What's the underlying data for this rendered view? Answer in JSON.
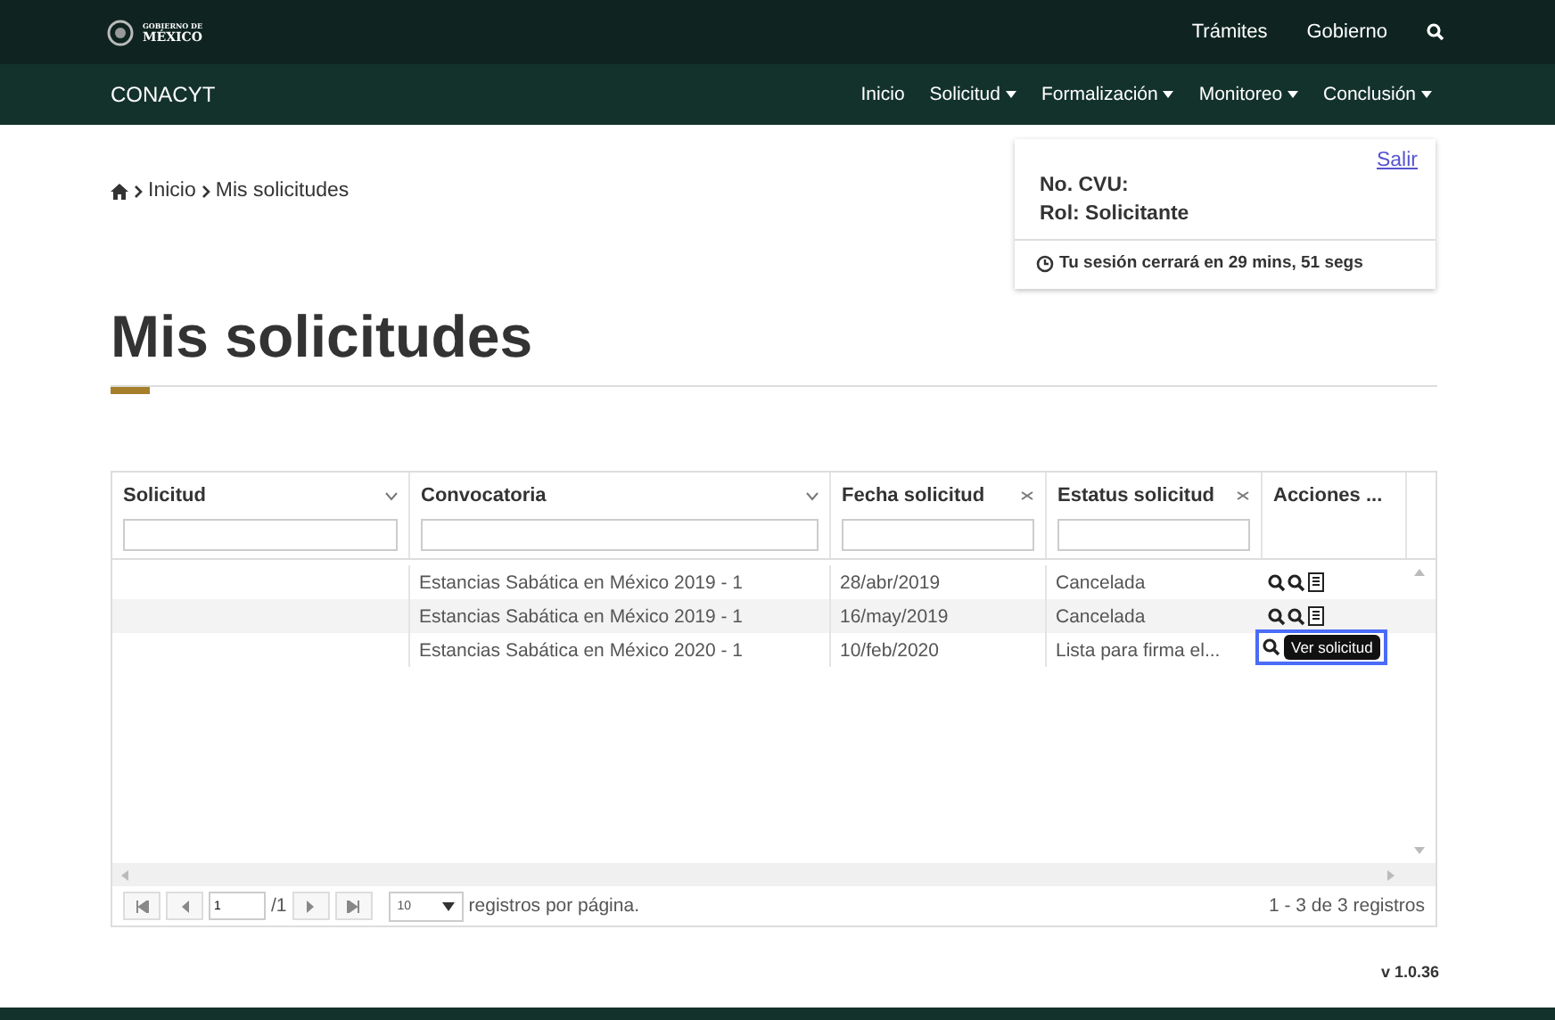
{
  "top_bar": {
    "logo_line_1": "GOBIERNO DE",
    "logo_line_2": "MÉXICO",
    "links": [
      "Trámites",
      "Gobierno"
    ]
  },
  "nav": {
    "brand": "CONACYT",
    "items": [
      {
        "label": "Inicio",
        "dropdown": false
      },
      {
        "label": "Solicitud",
        "dropdown": true
      },
      {
        "label": "Formalización",
        "dropdown": true
      },
      {
        "label": "Monitoreo",
        "dropdown": true
      },
      {
        "label": "Conclusión",
        "dropdown": true
      }
    ]
  },
  "breadcrumb": [
    "Inicio",
    "Mis solicitudes"
  ],
  "session": {
    "logout": "Salir",
    "cvu": "No. CVU:",
    "role": "Rol: Solicitante",
    "timer": "Tu sesión cerrará en 29 mins, 51 segs"
  },
  "title": "Mis solicitudes",
  "table": {
    "columns": [
      {
        "label": "Solicitud",
        "kind": "menu"
      },
      {
        "label": "Convocatoria",
        "kind": "menu"
      },
      {
        "label": "Fecha solicitud",
        "kind": "clear"
      },
      {
        "label": "Estatus solicitud",
        "kind": "clear"
      },
      {
        "label": "Acciones ...",
        "kind": "none"
      }
    ],
    "rows": [
      {
        "convocatoria": "Estancias Sabática en México 2019 - 1",
        "fecha": "28/abr/2019",
        "estatus": "Cancelada",
        "tooltip": null
      },
      {
        "convocatoria": "Estancias Sabática en México 2019 - 1",
        "fecha": "16/may/2019",
        "estatus": "Cancelada",
        "tooltip": null
      },
      {
        "convocatoria": "Estancias Sabática en México 2020 - 1",
        "fecha": "10/feb/2020",
        "estatus": "Lista para firma el...",
        "tooltip": "Ver solicitud"
      }
    ],
    "pager": {
      "page": "1",
      "total_pages": "/1",
      "page_size": "10",
      "page_size_label": "registros por página.",
      "summary_start": "1",
      "summary_separator": "-",
      "summary_rest": "3 de 3 registros"
    }
  },
  "version": "v 1.0.36"
}
